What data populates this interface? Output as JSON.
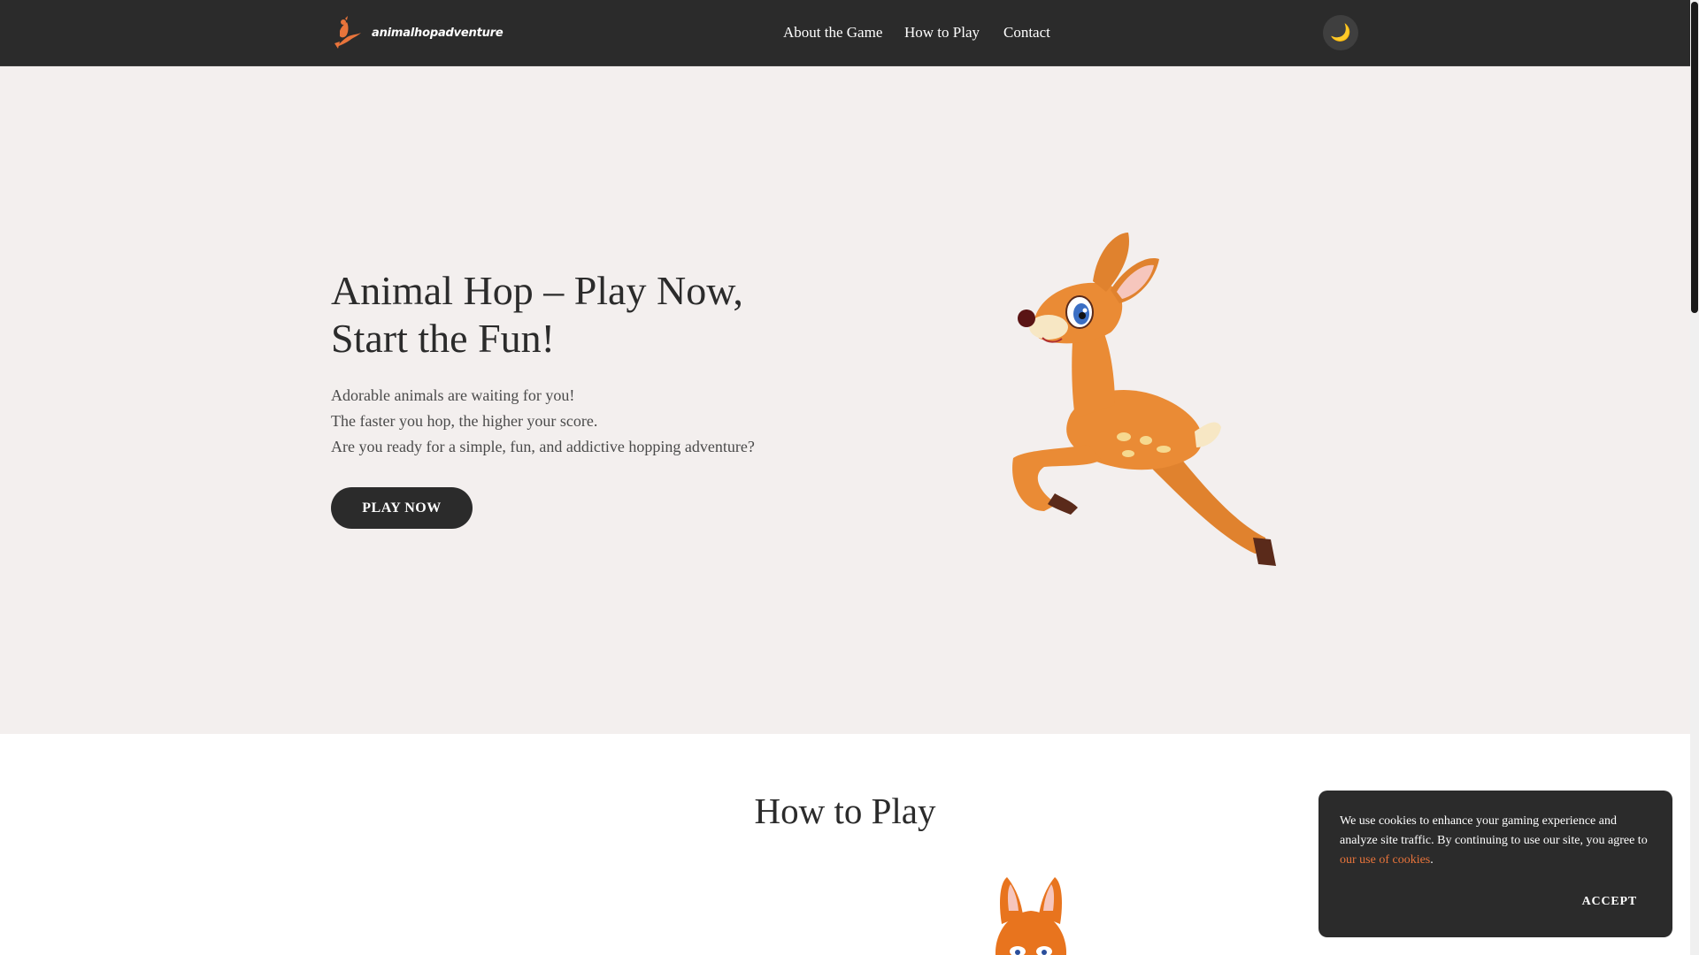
{
  "header": {
    "logo_text": "animalhopadventure",
    "nav": [
      "About the Game",
      "How to Play",
      "Contact"
    ],
    "theme_toggle_icon": "moon-icon"
  },
  "hero": {
    "title": "Animal Hop – Play Now, Start the Fun!",
    "lines": [
      "Adorable animals are waiting for you!",
      "The faster you hop, the higher your score.",
      "Are you ready for a simple, fun, and addictive hopping adventure?"
    ],
    "cta_label": "PLAY NOW"
  },
  "how_to_play": {
    "title": "How to Play"
  },
  "cookie": {
    "text_before": "We use cookies to enhance your gaming experience and analyze site traffic. By continuing to use our site, you agree to ",
    "link_text": "our use of cookies",
    "text_after": ".",
    "accept_label": "ACCEPT"
  },
  "colors": {
    "header_bg": "#2b2b2b",
    "hero_bg": "#f3efee",
    "accent": "#e8743b"
  }
}
